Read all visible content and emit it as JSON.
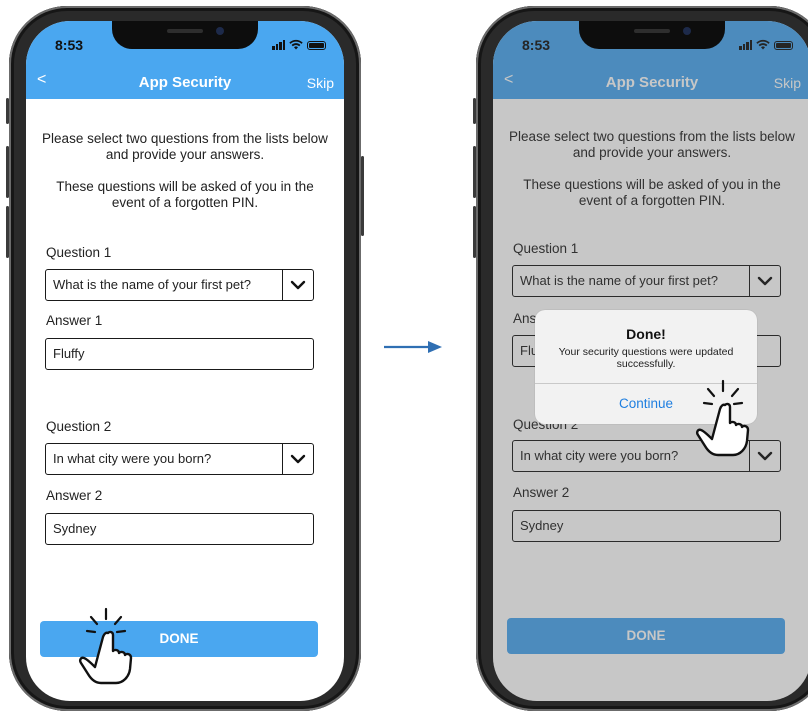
{
  "arrow_icon": "arrow-right-icon",
  "screens": [
    {
      "status": {
        "time": "8:53"
      },
      "nav": {
        "back": "<",
        "title": "App Security",
        "skip": "Skip"
      },
      "intro1": "Please select two questions from the lists below and provide your answers.",
      "intro2": "These questions will be asked of you in the event of a forgotten PIN.",
      "q1_label": "Question 1",
      "q1_value": "What is the name of your first pet?",
      "a1_label": "Answer 1",
      "a1_value": "Fluffy",
      "q2_label": "Question 2",
      "q2_value": "In what city were you born?",
      "a2_label": "Answer 2",
      "a2_value": "Sydney",
      "done_label": "DONE"
    },
    {
      "status": {
        "time": "8:53"
      },
      "nav": {
        "back": "<",
        "title": "App Security",
        "skip": "Skip"
      },
      "intro1": "Please select two questions from the lists below and provide your answers.",
      "intro2": "These questions will be asked of you in the event of a forgotten PIN.",
      "q1_label": "Question 1",
      "q1_value": "What is the name of your first pet?",
      "a1_label": "Answer 1",
      "a1_value": "Fluffy",
      "q2_label": "Question 2",
      "q2_value": "In what city were you born?",
      "a2_label": "Answer 2",
      "a2_value": "Sydney",
      "done_label": "DONE",
      "alert": {
        "title": "Done!",
        "message": "Your security questions were updated successfully.",
        "button": "Continue"
      }
    }
  ],
  "colors": {
    "accent": "#4aa7f0",
    "link": "#1f7fe0"
  }
}
